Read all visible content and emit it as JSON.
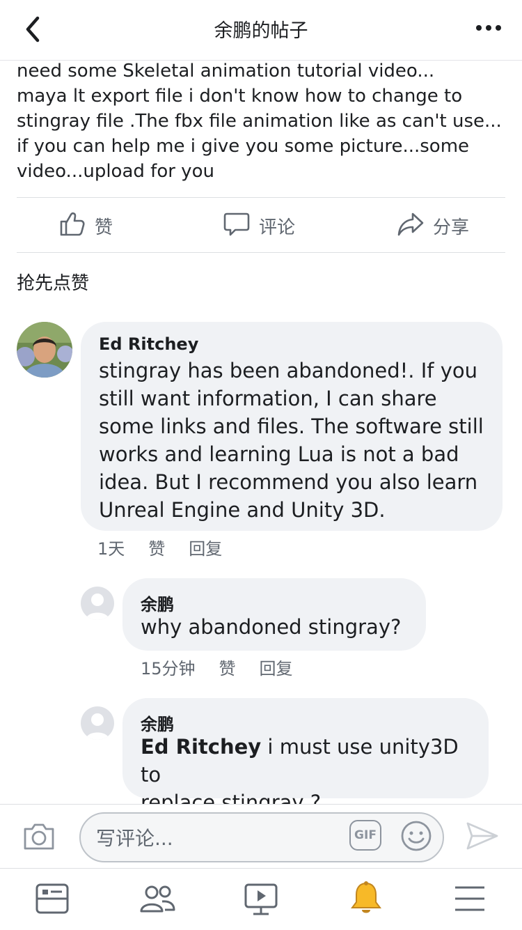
{
  "header": {
    "title": "余鹏的帖子",
    "back_icon": "chevron-left-icon",
    "more_icon": "more-dots-icon"
  },
  "post": {
    "text_lines": [
      "need some Skeletal animation tutorial video...",
      "maya lt export file i don't know how to change to",
      "stingray file .The fbx file animation like as can't use...",
      "if you can help me i give you some picture...some",
      "video...upload for you"
    ]
  },
  "actions": {
    "like_label": "赞",
    "comment_label": "评论",
    "share_label": "分享"
  },
  "like_first": "抢先点赞",
  "comments": [
    {
      "name": "Ed Ritchey",
      "lines": [
        "stingray has been abandoned!.  If you",
        "still want information, I can share",
        "some links and files.  The software still",
        "works and learning Lua is not a bad",
        "idea.  But I recommend you also learn",
        "Unreal Engine and Unity 3D."
      ],
      "time": "1天",
      "like": "赞",
      "reply": "回复"
    },
    {
      "name": "余鹏",
      "lines": [
        "why abandoned stingray?"
      ],
      "time": "15分钟",
      "like": "赞",
      "reply": "回复"
    },
    {
      "name": "余鹏",
      "mention": "Ed Ritchey",
      "lines": [
        " i must use unity3D to",
        "replace stingray ?"
      ]
    }
  ],
  "composer": {
    "placeholder": "写评论...",
    "gif_label": "GIF",
    "camera_icon": "camera-icon",
    "emoji_icon": "emoji-icon",
    "send_icon": "send-icon"
  },
  "bottom_nav": {
    "items": [
      "news-feed-icon",
      "friends-icon",
      "watch-icon",
      "notifications-bell-icon",
      "menu-icon"
    ],
    "active_color": "#f7b928"
  }
}
